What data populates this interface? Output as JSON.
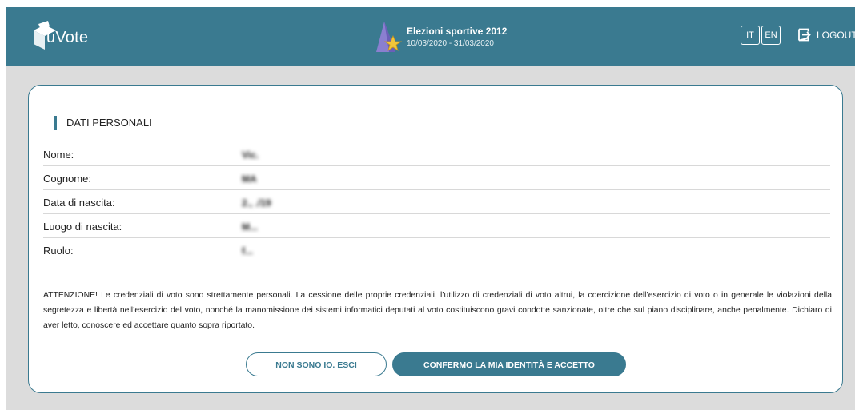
{
  "app": {
    "name": "uVote"
  },
  "election": {
    "title": "Elezioni sportive 2012",
    "dates": "10/03/2020 - 31/03/2020",
    "icon": "wizard-hat-star-icon"
  },
  "header": {
    "languages": [
      "IT",
      "EN"
    ],
    "logout_label": "LOGOUT"
  },
  "colors": {
    "brand": "#3a7a90",
    "background": "#dcdcdc"
  },
  "personal": {
    "title": "DATI PERSONALI",
    "rows": [
      {
        "label": "Nome:",
        "value": "Vic."
      },
      {
        "label": "Cognome:",
        "value": "MA"
      },
      {
        "label": "Data di nascita:",
        "value": "2., ./19"
      },
      {
        "label": "Luogo di nascita:",
        "value": "M..."
      },
      {
        "label": "Ruolo:",
        "value": "f..."
      }
    ]
  },
  "warning": "ATTENZIONE! Le credenziali di voto sono strettamente personali. La cessione delle proprie credenziali, l’utilizzo di credenziali di voto altrui, la coercizione dell’esercizio di voto o in generale le violazioni della segretezza e libertà nell’esercizio del voto, nonché la manomissione dei sistemi informatici deputati al voto costituiscono gravi condotte sanzionate, oltre che sul piano disciplinare, anche penalmente. Dichiaro di aver letto, conoscere ed accettare quanto sopra riportato.",
  "actions": {
    "exit_label": "NON SONO IO. ESCI",
    "confirm_label": "CONFERMO LA MIA IDENTITÀ E ACCETTO"
  }
}
